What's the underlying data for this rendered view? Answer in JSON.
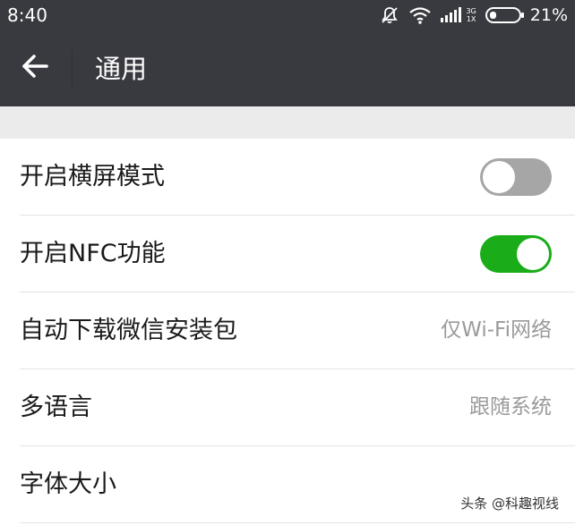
{
  "status_bar": {
    "time": "8:40",
    "network_top": "3G",
    "network_bottom": "1X",
    "battery_percent": "21%",
    "icons": [
      "mute-icon",
      "wifi-icon",
      "signal-icon",
      "battery-icon"
    ]
  },
  "header": {
    "title": "通用",
    "back_icon": "arrow-left-icon"
  },
  "settings": {
    "items": [
      {
        "label": "开启横屏模式",
        "type": "toggle",
        "enabled": false
      },
      {
        "label": "开启NFC功能",
        "type": "toggle",
        "enabled": true
      },
      {
        "label": "自动下载微信安装包",
        "type": "value",
        "value": "仅Wi-Fi网络"
      },
      {
        "label": "多语言",
        "type": "value",
        "value": "跟随系统"
      },
      {
        "label": "字体大小",
        "type": "link"
      }
    ]
  },
  "watermark": "头条 @科趣视线",
  "colors": {
    "header_bg": "#393a3f",
    "toggle_on": "#1aad19",
    "toggle_off": "#a6a6a6",
    "section_gap": "#ebebeb"
  }
}
